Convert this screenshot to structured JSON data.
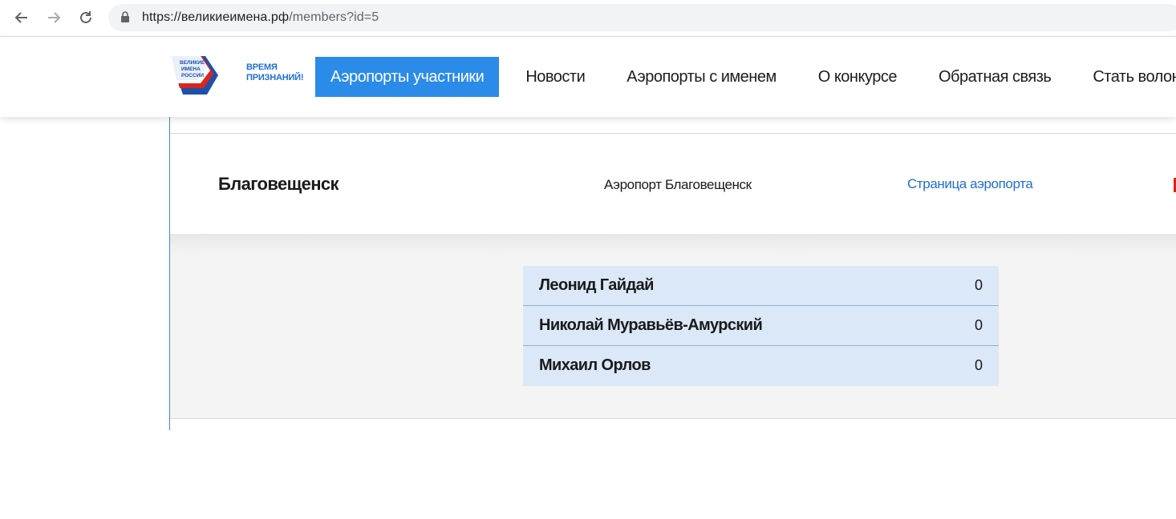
{
  "browser": {
    "url_host": "https://великиеимена.рф",
    "url_path": "/members?id=5",
    "back_icon": "arrow-left-icon",
    "forward_icon": "arrow-right-icon",
    "reload_icon": "reload-icon",
    "lock_icon": "lock-icon"
  },
  "header": {
    "logo_text": [
      "ВЕЛИКИЕ",
      "ИМЕНА",
      "РОССИИ"
    ],
    "slogan": [
      "ВРЕМЯ",
      "ПРИЗНАНИЙ!"
    ],
    "nav": [
      {
        "label": "Аэропорты участники",
        "active": true
      },
      {
        "label": "Новости",
        "active": false
      },
      {
        "label": "Аэропорты с именем",
        "active": false
      },
      {
        "label": "О конкурсе",
        "active": false
      },
      {
        "label": "Обратная связь",
        "active": false
      },
      {
        "label": "Стать волонтером",
        "active": false
      }
    ]
  },
  "airport": {
    "city": "Благовещенск",
    "name": "Аэропорт Благовещенск",
    "link_label": "Страница аэропорта"
  },
  "candidates": [
    {
      "name": "Леонид Гайдай",
      "votes": "0"
    },
    {
      "name": "Николай Муравьёв-Амурский",
      "votes": "0"
    },
    {
      "name": "Михаил Орлов",
      "votes": "0"
    }
  ],
  "colors": {
    "accent": "#2b8be8",
    "link": "#1f6fd6",
    "candidate_bg": "#dbe8f7",
    "logo_red": "#d9261c",
    "logo_blue": "#1f4fa8"
  }
}
